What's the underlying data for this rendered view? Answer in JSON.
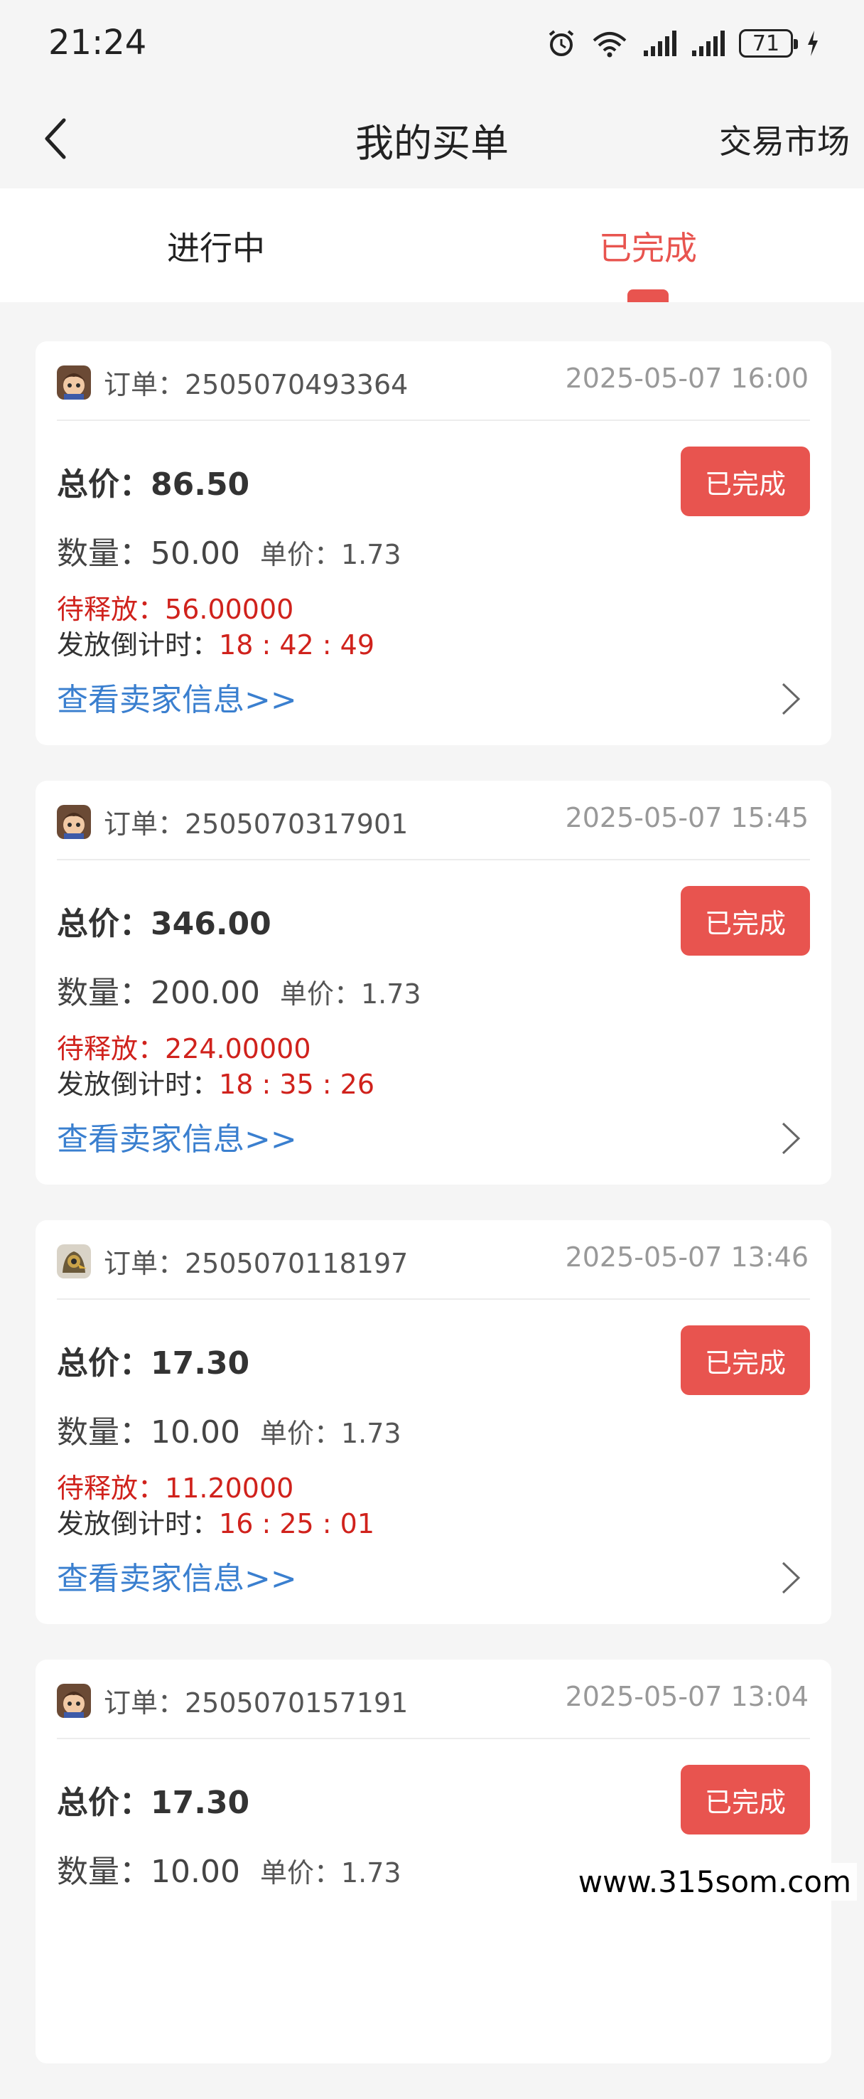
{
  "status_bar": {
    "time": "21:24",
    "battery": "71"
  },
  "nav": {
    "title": "我的买单",
    "right_label": "交易市场"
  },
  "tabs": [
    {
      "label": "进行中"
    },
    {
      "label": "已完成"
    }
  ],
  "colors": {
    "accent": "#e8544f",
    "pending": "#d0221c",
    "link": "#3a7fcf"
  },
  "orders": [
    {
      "order_label": "订单：2505070493364",
      "date": "2025-05-07 16:00",
      "total_label": "总价：",
      "total": "86.50",
      "status": "已完成",
      "qty_label": "数量：",
      "qty": "50.00",
      "unit_label": "单价：",
      "unit_price": "1.73",
      "pending_label": "待释放：",
      "pending": "56.00000",
      "countdown_label": "发放倒计时：",
      "countdown": "18 : 42 : 49",
      "seller_link": "查看卖家信息>>"
    },
    {
      "order_label": "订单：2505070317901",
      "date": "2025-05-07 15:45",
      "total_label": "总价：",
      "total": "346.00",
      "status": "已完成",
      "qty_label": "数量：",
      "qty": "200.00",
      "unit_label": "单价：",
      "unit_price": "1.73",
      "pending_label": "待释放：",
      "pending": "224.00000",
      "countdown_label": "发放倒计时：",
      "countdown": "18 : 35 : 26",
      "seller_link": "查看卖家信息>>"
    },
    {
      "order_label": "订单：2505070118197",
      "date": "2025-05-07 13:46",
      "total_label": "总价：",
      "total": "17.30",
      "status": "已完成",
      "qty_label": "数量：",
      "qty": "10.00",
      "unit_label": "单价：",
      "unit_price": "1.73",
      "pending_label": "待释放：",
      "pending": "11.20000",
      "countdown_label": "发放倒计时：",
      "countdown": "16 : 25 : 01",
      "seller_link": "查看卖家信息>>"
    },
    {
      "order_label": "订单：2505070157191",
      "date": "2025-05-07 13:04",
      "total_label": "总价：",
      "total": "17.30",
      "status": "已完成",
      "qty_label": "数量：",
      "qty": "10.00",
      "unit_label": "单价：",
      "unit_price": "1.73"
    }
  ],
  "watermark": "www.315som.com"
}
